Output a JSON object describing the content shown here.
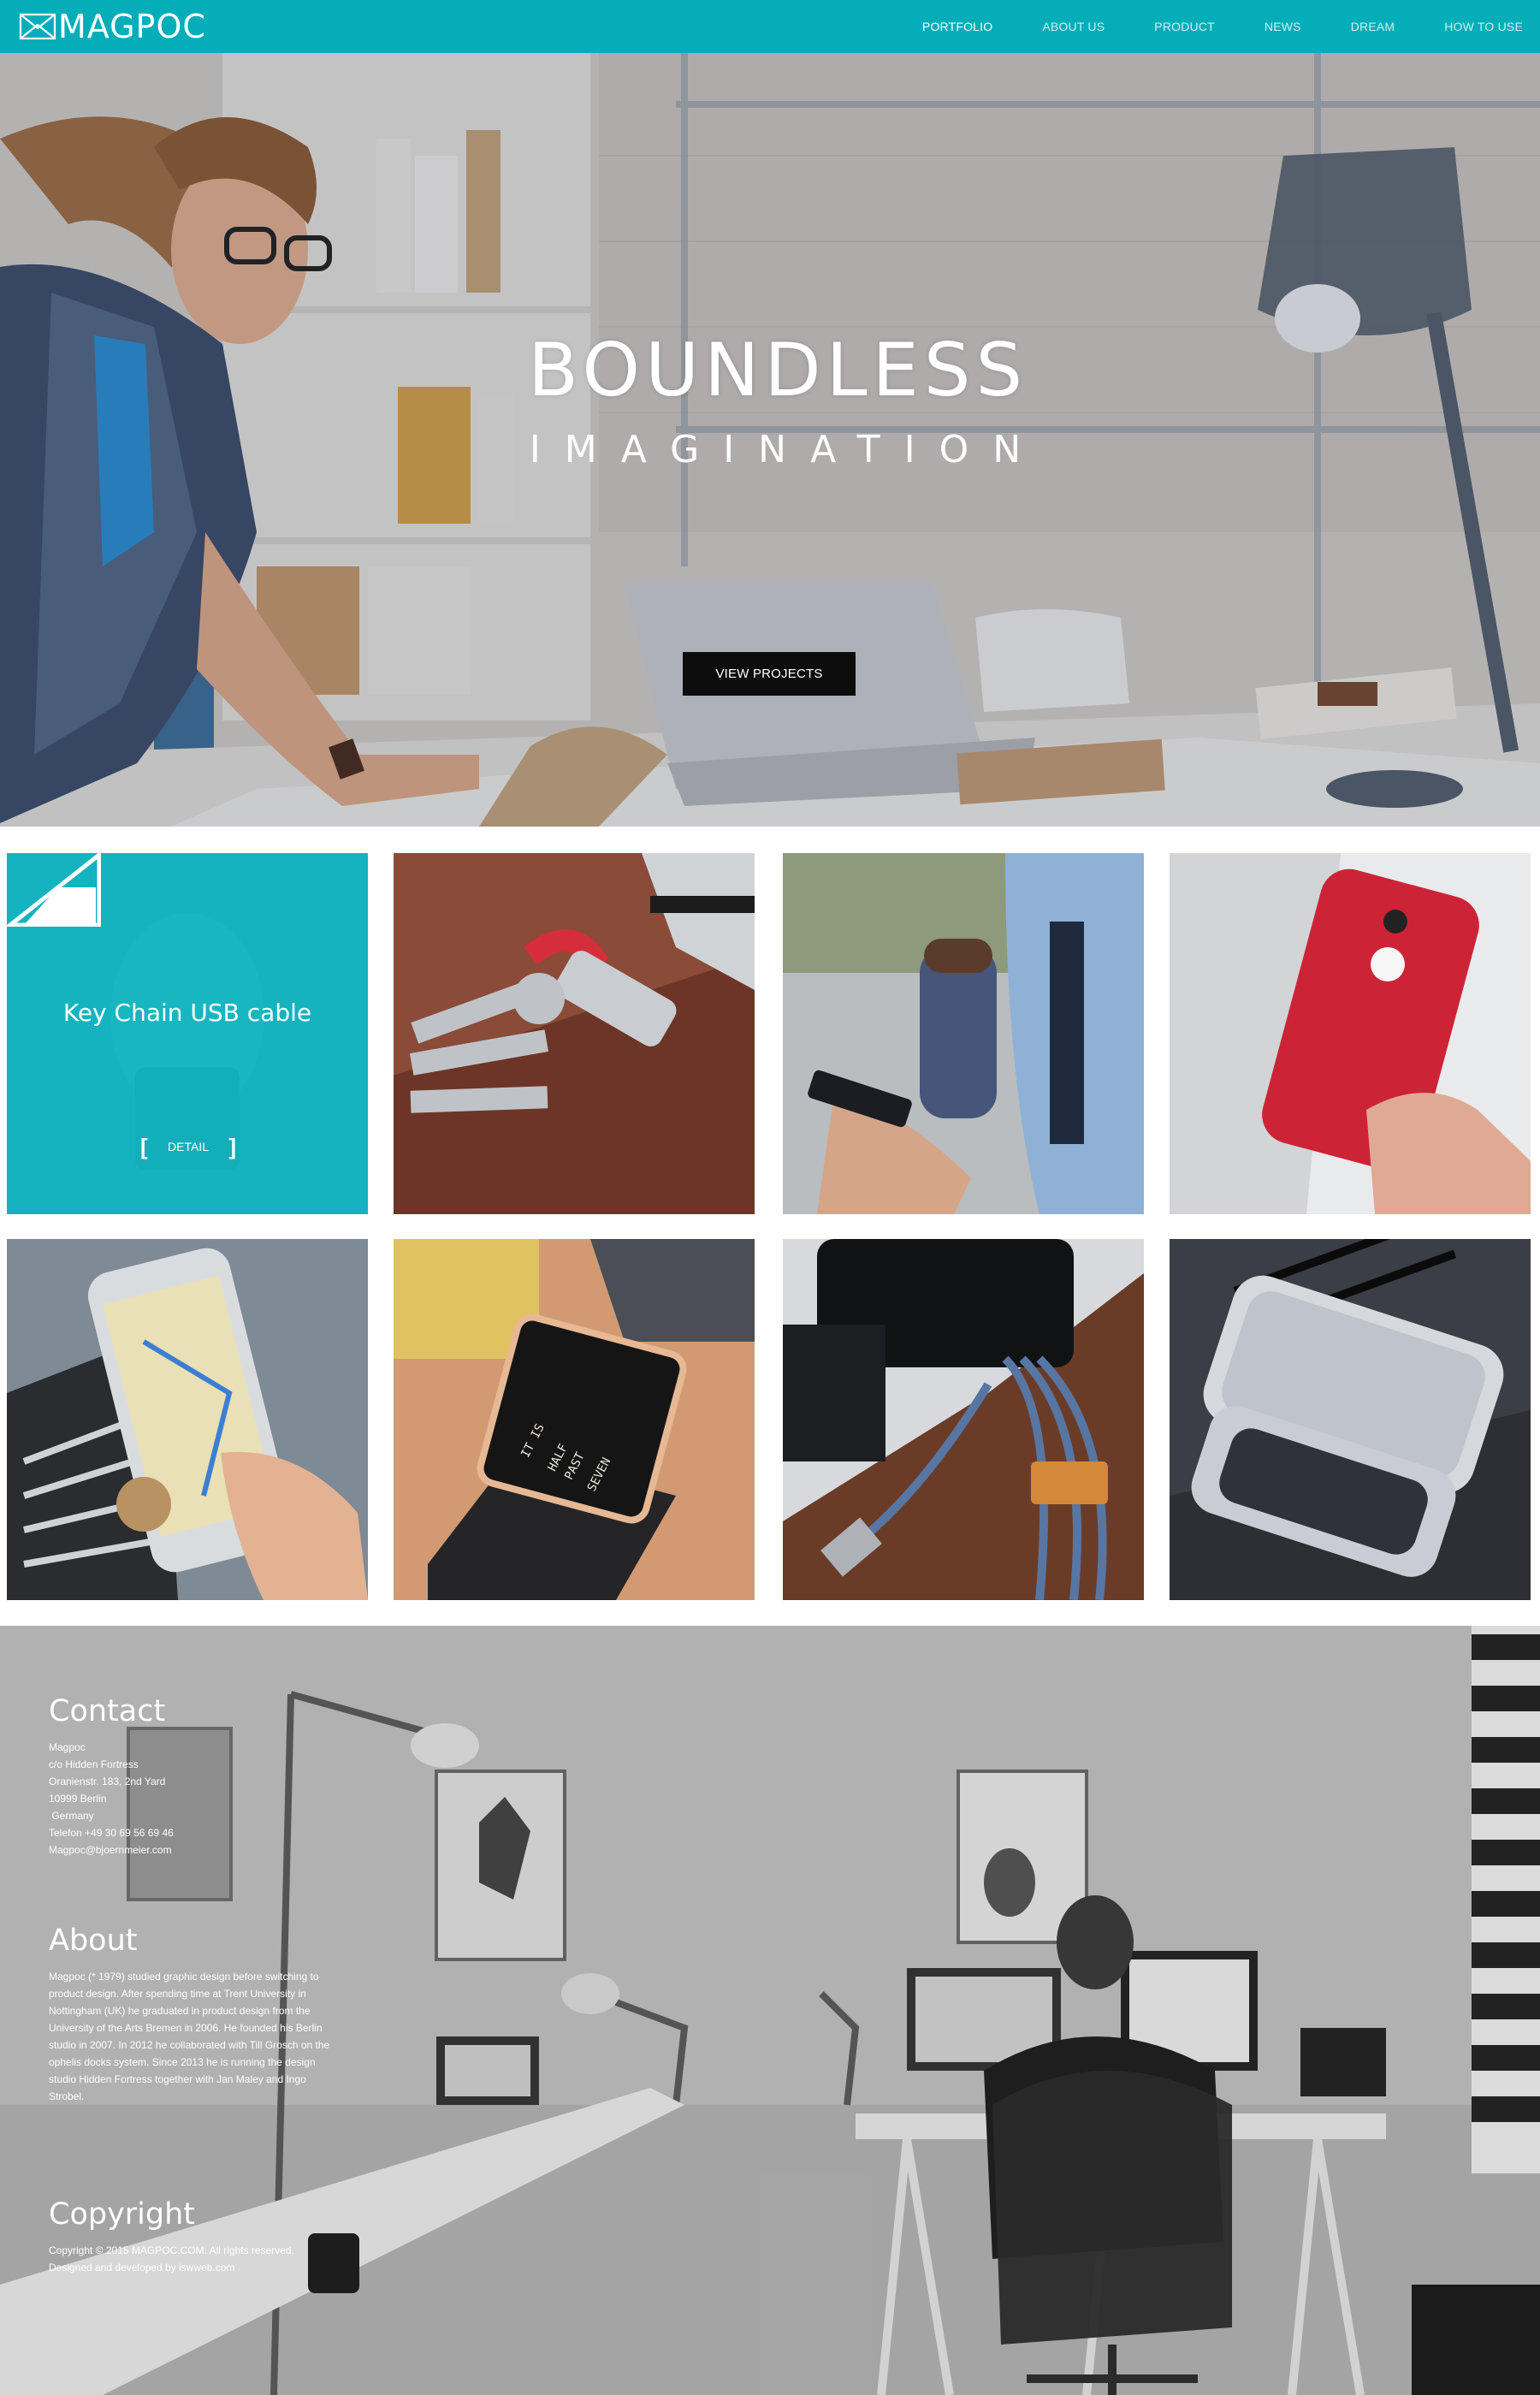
{
  "header": {
    "logo_text": "MAGPOC",
    "nav": [
      "PORTFOLIO",
      "ABOUT US",
      "PRODUCT",
      "NEWS",
      "DREAM",
      "HOW TO USE"
    ],
    "active_index": 0,
    "bar_color": "#04aeb9"
  },
  "hero": {
    "title": "BOUNDLESS",
    "subtitle": "IMAGINATION",
    "button_label": "VIEW PROJECTS"
  },
  "portfolio": {
    "featured": {
      "name": "Key Chain USB cable",
      "detail_label": "DETAIL",
      "bracket_left": "[",
      "bracket_right": "]",
      "accent_color": "#0cb4c0"
    },
    "tiles": [
      {
        "subject": "keys-usb-keychain-photo"
      },
      {
        "subject": "tumbler-phone-photo"
      },
      {
        "subject": "red-phone-case-photo"
      },
      {
        "subject": "car-phone-mount-photo"
      },
      {
        "subject": "square-watch-photo"
      },
      {
        "subject": "denim-usb-cable-photo"
      },
      {
        "subject": "phone-bumper-photo"
      }
    ]
  },
  "footer": {
    "contact": {
      "heading": "Contact",
      "lines": [
        "Magpoc",
        "c/o Hidden Fortress",
        "Oranienstr. 183, 2nd Yard",
        "10999 Berlin",
        " Germany",
        "",
        "Telefon +49 30 69 56 69 46",
        "Magpoc@bjoernmeier.com"
      ]
    },
    "about": {
      "heading": "About",
      "text": "Magpoc (* 1979) studied graphic design before switching to product design. After spending time at Trent University in Nottingham (UK) he graduated in product design from the University of the Arts Bremen in 2006. He founded his Berlin studio in 2007. In 2012 he collaborated with Till Grosch on the ophelis docks system. Since 2013 he is running the design studio Hidden Fortress together with Jan Maley and Ingo Strobel."
    },
    "copyright": {
      "heading": "Copyright",
      "lines": [
        "Copyright © 2015 MAGPOC.COM. All rights reserved.",
        "Designed and developed by iswweb.com"
      ]
    }
  }
}
